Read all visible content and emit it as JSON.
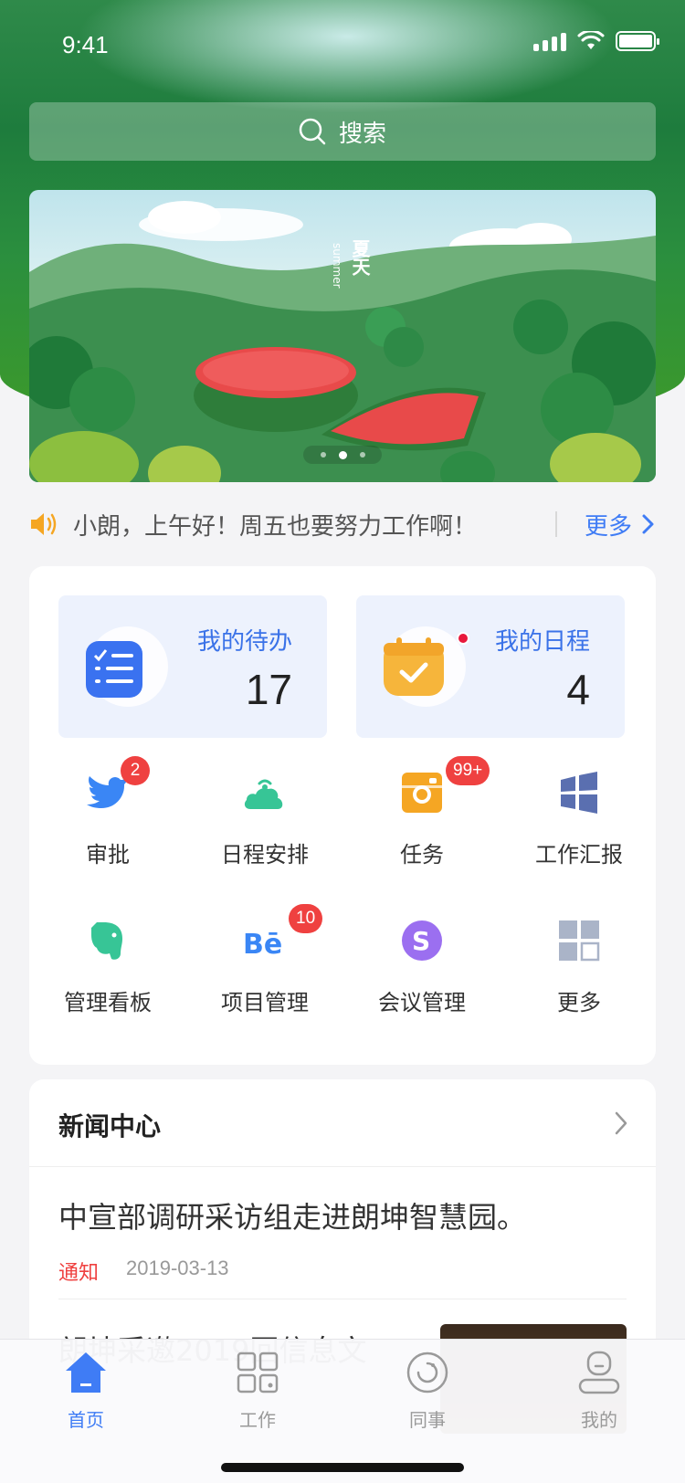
{
  "status_bar": {
    "time": "9:41"
  },
  "search": {
    "placeholder": "搜索",
    "icon": "search-icon"
  },
  "banner": {
    "caption_en": "summer",
    "caption_cn": "夏天",
    "slide_count": 3,
    "active_slide": 2
  },
  "notice": {
    "icon": "speaker-icon",
    "text": "小朗，上午好！周五也要努力工作啊！",
    "more_label": "更多"
  },
  "summary": {
    "todo": {
      "title": "我的待办",
      "count": "17",
      "icon": "checklist-icon"
    },
    "schedule": {
      "title": "我的日程",
      "count": "4",
      "icon": "calendar-check-icon",
      "has_dot": true
    }
  },
  "apps": [
    {
      "label": "审批",
      "icon": "bird-icon",
      "badge": "2",
      "color": "#3a86f5"
    },
    {
      "label": "日程安排",
      "icon": "cloud-signal-icon",
      "badge": "",
      "color": "#37c596"
    },
    {
      "label": "任务",
      "icon": "camera-icon",
      "badge": "99+",
      "color": "#f5a623"
    },
    {
      "label": "工作汇报",
      "icon": "windows-icon",
      "badge": "",
      "color": "#5a6fb0"
    },
    {
      "label": "管理看板",
      "icon": "elephant-icon",
      "badge": "",
      "color": "#37c596"
    },
    {
      "label": "项目管理",
      "icon": "behance-icon",
      "badge": "10",
      "color": "#3a86f5"
    },
    {
      "label": "会议管理",
      "icon": "skype-icon",
      "badge": "",
      "color": "#9b6ff0"
    },
    {
      "label": "更多",
      "icon": "grid-more-icon",
      "badge": "",
      "color": "#aab4c8"
    }
  ],
  "news": {
    "header": "新闻中心",
    "items": [
      {
        "title": "中宣部调研采访组走进朗坤智慧园。",
        "tag": "通知",
        "date": "2019-03-13"
      },
      {
        "title": "朗坤采邀2019回信息文"
      }
    ]
  },
  "tabs": [
    {
      "label": "首页",
      "icon": "home-icon",
      "active": true
    },
    {
      "label": "工作",
      "icon": "apps-grid-icon",
      "active": false
    },
    {
      "label": "同事",
      "icon": "colleague-icon",
      "active": false
    },
    {
      "label": "我的",
      "icon": "profile-icon",
      "active": false
    }
  ],
  "colors": {
    "accent": "#3f7cf5",
    "badge": "#ef4140",
    "notice_icon": "#f5a623"
  }
}
